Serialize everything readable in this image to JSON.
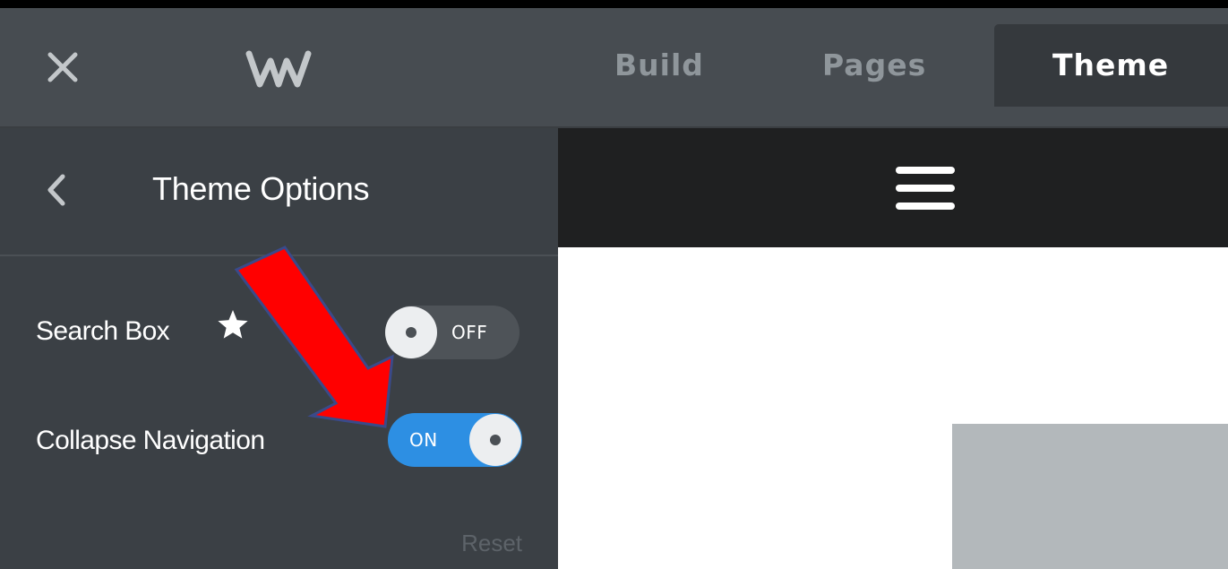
{
  "topbar": {
    "close_icon": "close-icon",
    "logo_icon": "weebly-logo",
    "tabs": [
      {
        "label": "Build",
        "active": false
      },
      {
        "label": "Pages",
        "active": false
      },
      {
        "label": "Theme",
        "active": true
      }
    ]
  },
  "sidebar": {
    "back_icon": "chevron-left-icon",
    "title": "Theme Options",
    "options": [
      {
        "label": "Search Box",
        "icon": "star-icon",
        "toggle_label": "OFF",
        "state": false
      },
      {
        "label": "Collapse Navigation",
        "toggle_label": "ON",
        "state": true
      }
    ],
    "reset_label": "Reset"
  },
  "preview": {
    "menu_icon": "hamburger-icon"
  },
  "annotation": {
    "arrow_icon": "red-arrow",
    "color": "#ff0000"
  },
  "colors": {
    "topbar_bg": "#474c51",
    "sidebar_bg": "#3b4045",
    "active_tab_bg": "#35393d",
    "toggle_on": "#2d8fe3",
    "toggle_off": "#4e5358"
  }
}
